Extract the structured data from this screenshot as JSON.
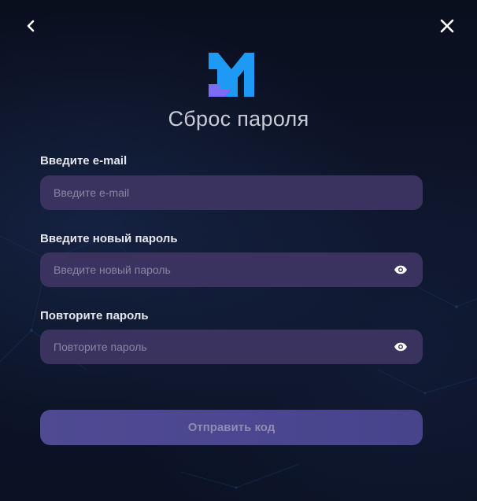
{
  "header": {
    "back_icon": "chevron-left-icon",
    "close_icon": "close-icon",
    "logo_icon": "brand-m-logo"
  },
  "title": "Сброс пароля",
  "form": {
    "email": {
      "label": "Введите e-mail",
      "placeholder": "Введите e-mail",
      "value": ""
    },
    "new_password": {
      "label": "Введите новый пароль",
      "placeholder": "Введите новый пароль",
      "value": "",
      "toggle_icon": "eye-icon"
    },
    "repeat_password": {
      "label": "Повторите пароль",
      "placeholder": "Повторите пароль",
      "value": "",
      "toggle_icon": "eye-icon"
    },
    "submit_label": "Отправить код"
  },
  "colors": {
    "background": "#0b1020",
    "input_bg": "#3a335f",
    "button_bg": "#4b4790",
    "button_text": "#8f8bb4",
    "logo_blue": "#1e9af5",
    "logo_purple": "#7b6cf2"
  }
}
